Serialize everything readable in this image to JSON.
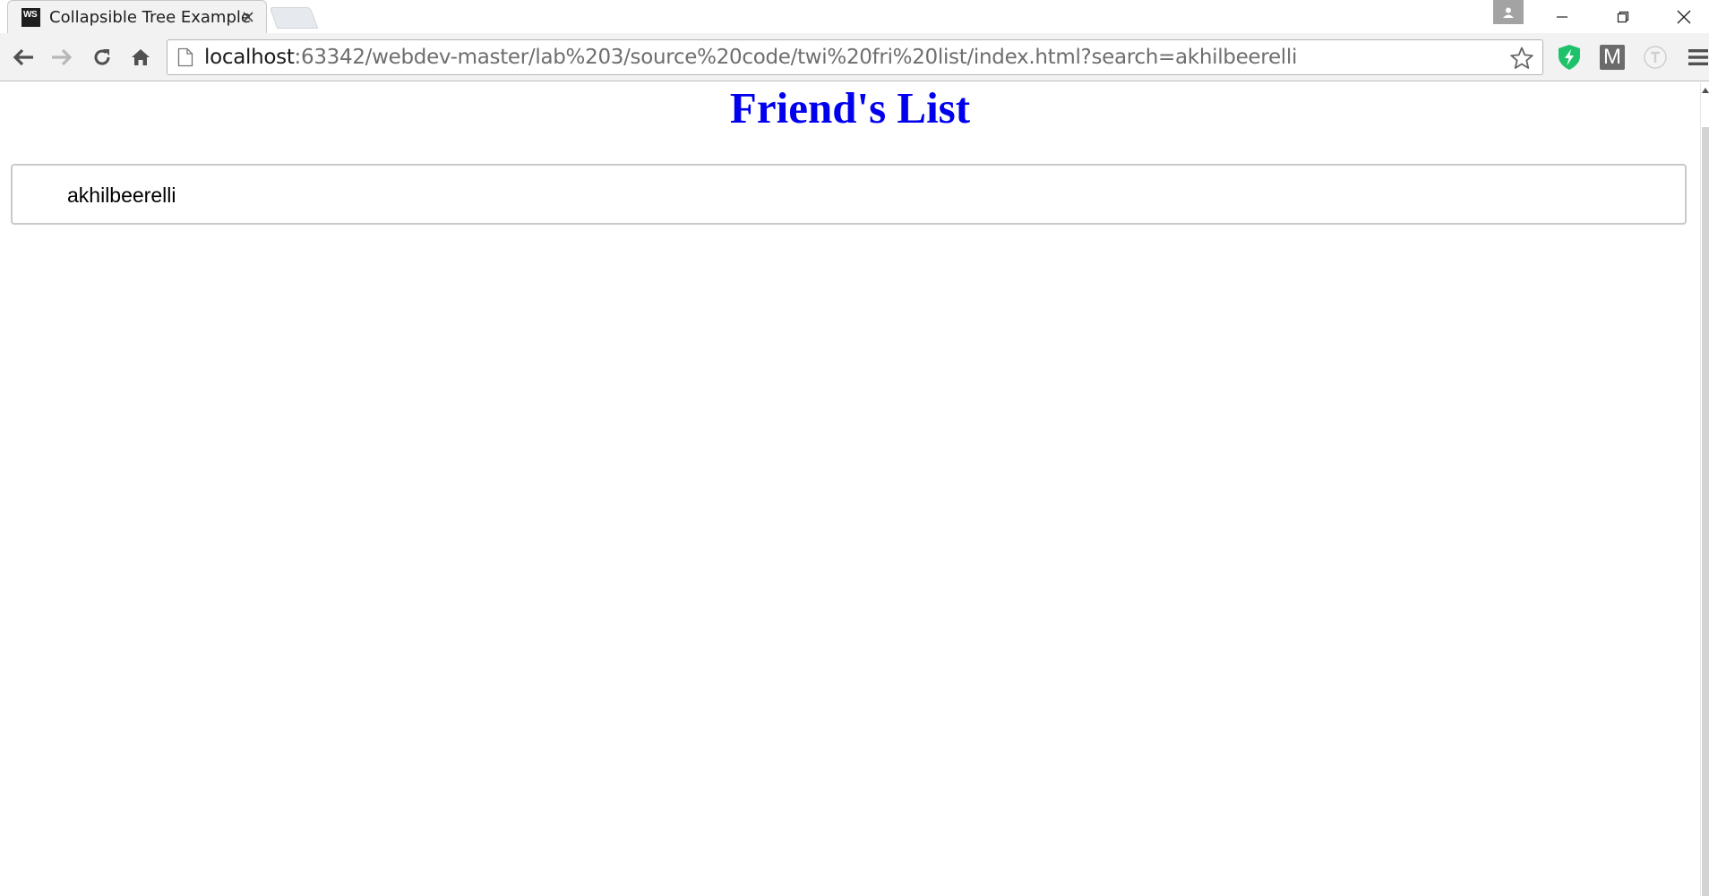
{
  "browser": {
    "tab": {
      "favicon_text": "WS",
      "title": "Collapsible Tree Example"
    },
    "address_bar": {
      "host": "localhost",
      "rest": ":63342/webdev-master/lab%203/source%20code/twi%20fri%20list/index.html?search=akhilbeerelli"
    },
    "extensions": {
      "m_label": "M"
    }
  },
  "page": {
    "title": "Friend's List",
    "friends": [
      "akhilbeerelli"
    ]
  },
  "colors": {
    "title": "#0000ee",
    "shield_extension": "#1ec26b",
    "box_border": "#c9c9c9"
  },
  "icons": [
    "back-arrow-icon",
    "forward-arrow-icon",
    "reload-icon",
    "home-icon",
    "page-icon",
    "star-icon",
    "shield-bolt-icon",
    "chrome-menu-icon",
    "profile-icon",
    "minimize-icon",
    "restore-icon",
    "close-icon"
  ]
}
